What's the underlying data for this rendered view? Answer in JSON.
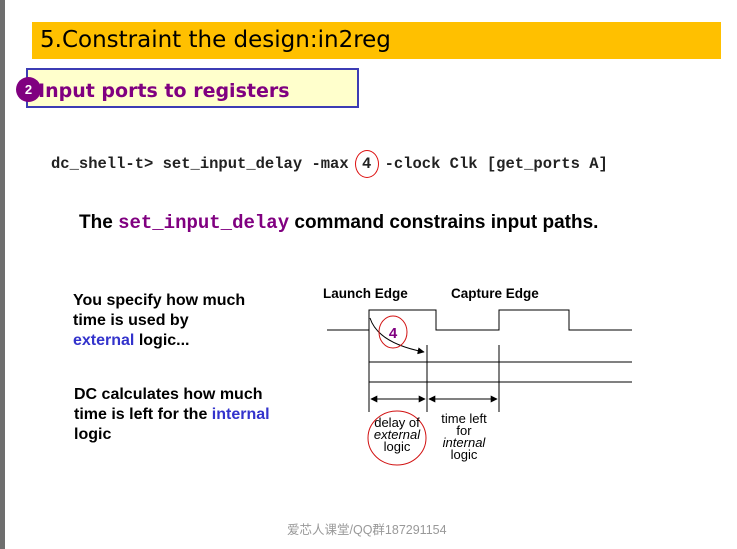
{
  "slide": {
    "title": "5.Constraint the design:in2reg",
    "subtitle": "Input ports to registers",
    "badge": "2"
  },
  "command": {
    "prefix": "dc_shell-t> set_input_delay -max ",
    "value": "4",
    "suffix": " -clock Clk [get_ports A]"
  },
  "sentence": {
    "before": "The ",
    "keyword": "set_input_delay",
    "after": " command constrains input paths."
  },
  "notes": {
    "specify_line1": "You specify how much",
    "specify_line2": "time is used by",
    "specify_blue": "external",
    "specify_end": " logic...",
    "calc_line1": "DC calculates how much",
    "calc_line2_before": "time is left for the ",
    "calc_blue": "internal",
    "calc_line3": "logic"
  },
  "diagram": {
    "launch_edge": "Launch Edge",
    "capture_edge": "Capture Edge",
    "delay_value": "4",
    "delay_label_line1": "delay of",
    "delay_label_line2": "external",
    "delay_label_line3": "logic",
    "left_label_line1": "time left",
    "left_label_line2": "for",
    "left_label_line3": "internal",
    "left_label_line4": "logic"
  },
  "footer": "爱芯人课堂/QQ群187291154",
  "colors": {
    "title_bar": "#ffc000",
    "subtitle_bg": "#ffffcc",
    "subtitle_text": "#800080",
    "accent_blue": "#3333cc",
    "annotation_red": "#d11111"
  }
}
